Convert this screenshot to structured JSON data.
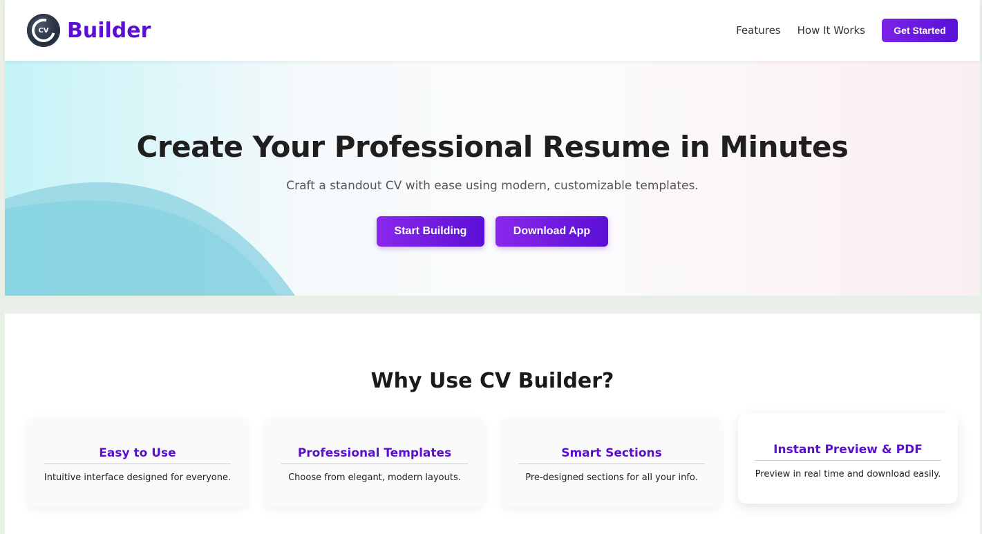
{
  "header": {
    "logo_text": "CV",
    "brand_name": "Builder",
    "nav": [
      {
        "label": "Features"
      },
      {
        "label": "How It Works"
      }
    ],
    "cta_label": "Get Started"
  },
  "hero": {
    "title": "Create Your Professional Resume in Minutes",
    "subtitle": "Craft a standout CV with ease using modern, customizable templates.",
    "primary_button": "Start Building",
    "secondary_button": "Download App"
  },
  "features": {
    "title": "Why Use CV Builder?",
    "cards": [
      {
        "title": "Easy to Use",
        "text": "Intuitive interface designed for everyone."
      },
      {
        "title": "Professional Templates",
        "text": "Choose from elegant, modern layouts."
      },
      {
        "title": "Smart Sections",
        "text": "Pre-designed sections for all your info."
      },
      {
        "title": "Instant Preview & PDF",
        "text": "Preview in real time and download easily."
      }
    ]
  },
  "colors": {
    "brand": "#5b0fd1",
    "button_gradient_start": "#8a28ec",
    "button_gradient_end": "#5b10d6"
  }
}
